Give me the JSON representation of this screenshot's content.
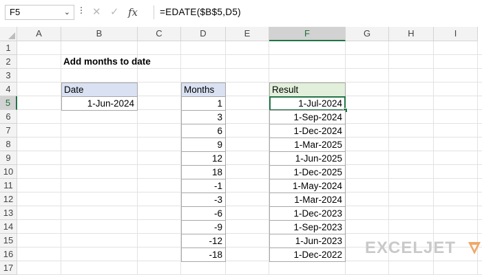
{
  "formula_bar": {
    "name_box": "F5",
    "formula": "=EDATE($B$5,D5)",
    "icons": [
      "chevron-down-icon",
      "cancel-icon",
      "enter-icon",
      "function-icon"
    ]
  },
  "columns": [
    "A",
    "B",
    "C",
    "D",
    "E",
    "F",
    "G",
    "H",
    "I"
  ],
  "selected_column": "F",
  "rows": [
    "1",
    "2",
    "3",
    "4",
    "5",
    "6",
    "7",
    "8",
    "9",
    "10",
    "11",
    "12",
    "13",
    "14",
    "15",
    "16",
    "17"
  ],
  "selected_row": "5",
  "sheet": {
    "title": "Add months to date",
    "date_header": "Date",
    "date_value": "1-Jun-2024",
    "months_header": "Months",
    "result_header": "Result",
    "table": [
      {
        "months": "1",
        "result": "1-Jul-2024"
      },
      {
        "months": "3",
        "result": "1-Sep-2024"
      },
      {
        "months": "6",
        "result": "1-Dec-2024"
      },
      {
        "months": "9",
        "result": "1-Mar-2025"
      },
      {
        "months": "12",
        "result": "1-Jun-2025"
      },
      {
        "months": "18",
        "result": "1-Dec-2025"
      },
      {
        "months": "-1",
        "result": "1-May-2024"
      },
      {
        "months": "-3",
        "result": "1-Mar-2024"
      },
      {
        "months": "-6",
        "result": "1-Dec-2023"
      },
      {
        "months": "-9",
        "result": "1-Sep-2023"
      },
      {
        "months": "-12",
        "result": "1-Jun-2023"
      },
      {
        "months": "-18",
        "result": "1-Dec-2022"
      }
    ]
  },
  "colors": {
    "accent": "#217346",
    "date_header_fill": "#d9e1f2",
    "result_header_fill": "#e2efda"
  },
  "logo": {
    "text": "EXCELJET",
    "mark_color": "#f0a868"
  }
}
